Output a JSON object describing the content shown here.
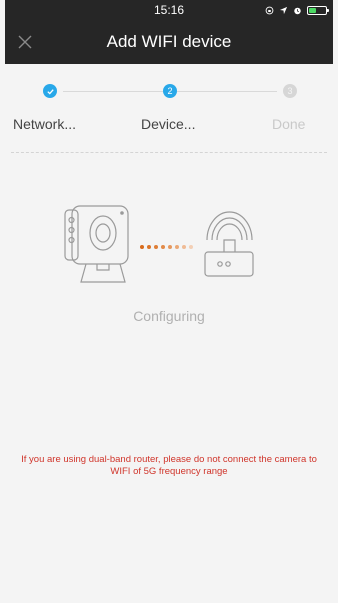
{
  "statusbar": {
    "time": "15:16"
  },
  "header": {
    "title": "Add WIFI device",
    "close_icon": "close-icon"
  },
  "steps": [
    {
      "label": "Network...",
      "state": "done"
    },
    {
      "label": "Device...",
      "state": "active",
      "number": "2"
    },
    {
      "label": "Done",
      "state": "pending",
      "number": "3"
    }
  ],
  "main": {
    "status": "Configuring",
    "warning": "If you are using dual-band router, please do not connect the camera to WIFI of 5G frequency range"
  },
  "colors": {
    "accent": "#28a8e9",
    "nav": "#262626",
    "warning": "#d0352b",
    "dots": "#e08a44"
  }
}
